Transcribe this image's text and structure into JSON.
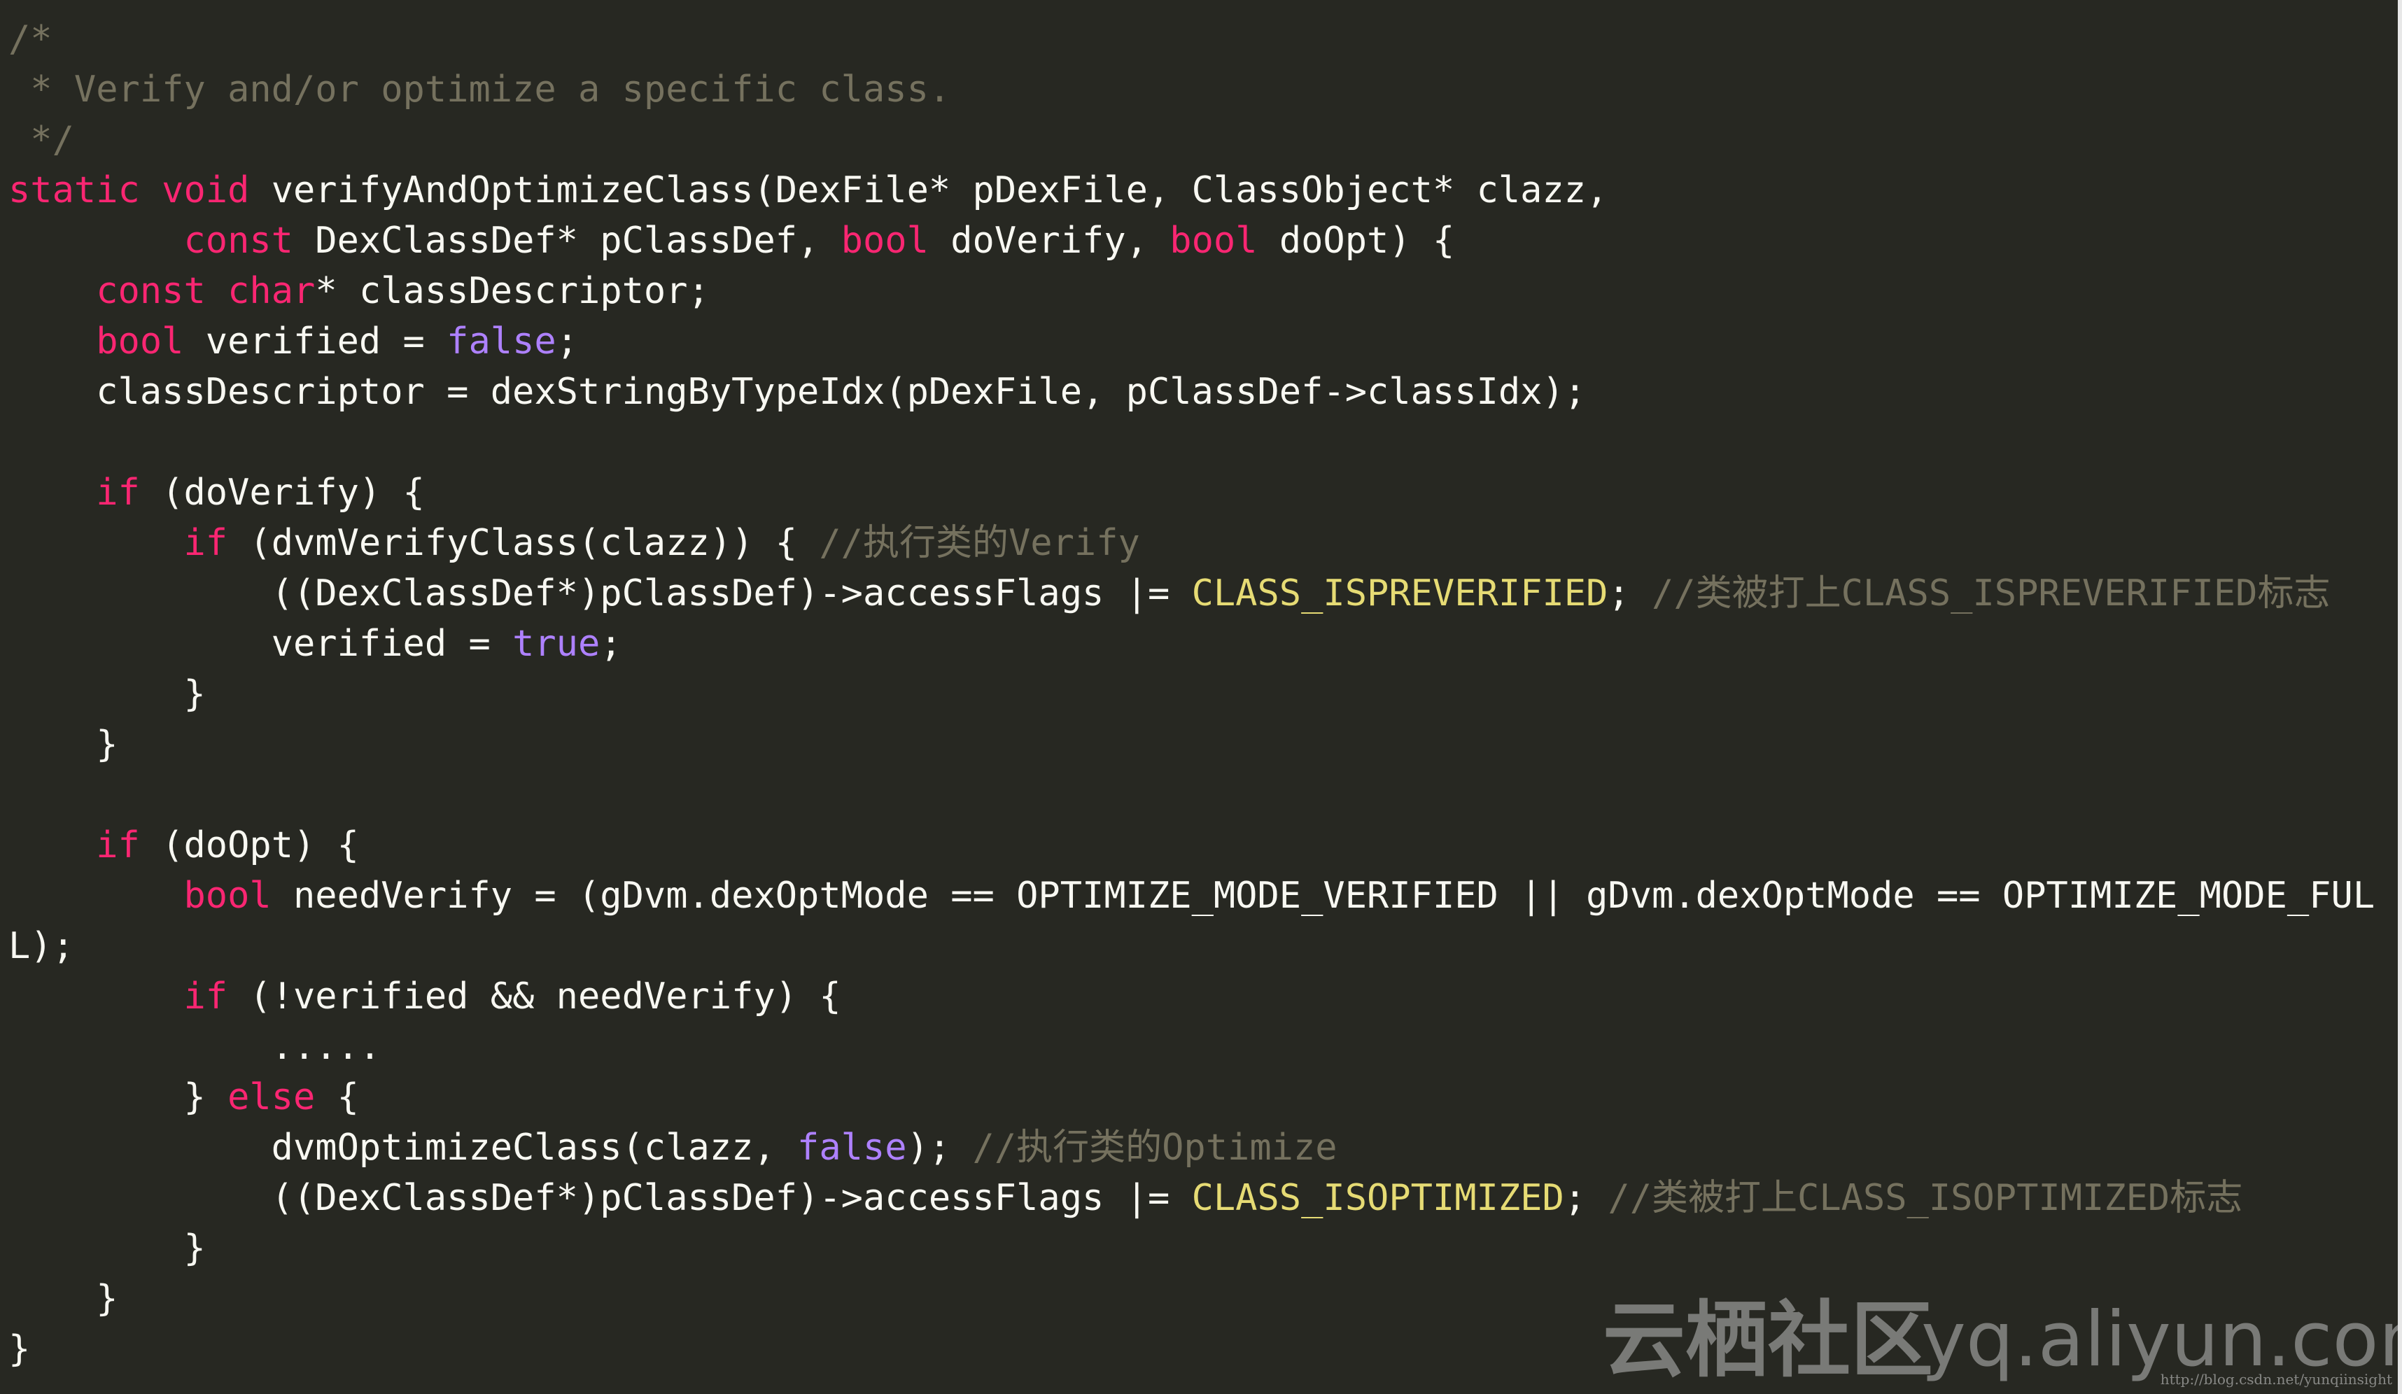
{
  "code_lines": [
    [
      {
        "t": "/*",
        "c": "cm"
      }
    ],
    [
      {
        "t": " * Verify and/or optimize a specific class.",
        "c": "cm"
      }
    ],
    [
      {
        "t": " */",
        "c": "cm"
      }
    ],
    [
      {
        "t": "static",
        "c": "kw"
      },
      {
        "t": " ",
        "c": "pl"
      },
      {
        "t": "void",
        "c": "kw"
      },
      {
        "t": " verifyAndOptimizeClass(DexFile* pDexFile, ClassObject* clazz,",
        "c": "pl"
      }
    ],
    [
      {
        "t": "        ",
        "c": "pl"
      },
      {
        "t": "const",
        "c": "kw"
      },
      {
        "t": " DexClassDef* pClassDef, ",
        "c": "pl"
      },
      {
        "t": "bool",
        "c": "kw"
      },
      {
        "t": " doVerify, ",
        "c": "pl"
      },
      {
        "t": "bool",
        "c": "kw"
      },
      {
        "t": " doOpt) {",
        "c": "pl"
      }
    ],
    [
      {
        "t": "    ",
        "c": "pl"
      },
      {
        "t": "const",
        "c": "kw"
      },
      {
        "t": " ",
        "c": "pl"
      },
      {
        "t": "char",
        "c": "kw"
      },
      {
        "t": "* classDescriptor;",
        "c": "pl"
      }
    ],
    [
      {
        "t": "    ",
        "c": "pl"
      },
      {
        "t": "bool",
        "c": "kw"
      },
      {
        "t": " verified = ",
        "c": "pl"
      },
      {
        "t": "false",
        "c": "cst"
      },
      {
        "t": ";",
        "c": "pl"
      }
    ],
    [
      {
        "t": "    classDescriptor = dexStringByTypeIdx(pDexFile, pClassDef->classIdx);",
        "c": "pl"
      }
    ],
    [],
    [
      {
        "t": "    ",
        "c": "pl"
      },
      {
        "t": "if",
        "c": "kw"
      },
      {
        "t": " (doVerify) {",
        "c": "pl"
      }
    ],
    [
      {
        "t": "        ",
        "c": "pl"
      },
      {
        "t": "if",
        "c": "kw"
      },
      {
        "t": " (dvmVerifyClass(clazz)) { ",
        "c": "pl"
      },
      {
        "t": "//执行类的Verify",
        "c": "cm"
      }
    ],
    [
      {
        "t": "            ((DexClassDef*)pClassDef)->accessFlags |= ",
        "c": "pl"
      },
      {
        "t": "CLASS_ISPREVERIFIED",
        "c": "mac"
      },
      {
        "t": "; ",
        "c": "pl"
      },
      {
        "t": "//类被打上CLASS_ISPREVERIFIED标志",
        "c": "cm"
      }
    ],
    [
      {
        "t": "            verified = ",
        "c": "pl"
      },
      {
        "t": "true",
        "c": "cst"
      },
      {
        "t": ";",
        "c": "pl"
      }
    ],
    [
      {
        "t": "        }",
        "c": "pl"
      }
    ],
    [
      {
        "t": "    }",
        "c": "pl"
      }
    ],
    [],
    [
      {
        "t": "    ",
        "c": "pl"
      },
      {
        "t": "if",
        "c": "kw"
      },
      {
        "t": " (doOpt) {",
        "c": "pl"
      }
    ],
    [
      {
        "t": "        ",
        "c": "pl"
      },
      {
        "t": "bool",
        "c": "kw"
      },
      {
        "t": " needVerify = (gDvm.dexOptMode == OPTIMIZE_MODE_VERIFIED || gDvm.dexOptMode == OPTIMIZE_MODE_FUL",
        "c": "pl"
      }
    ],
    [
      {
        "t": "L);",
        "c": "pl"
      }
    ],
    [
      {
        "t": "        ",
        "c": "pl"
      },
      {
        "t": "if",
        "c": "kw"
      },
      {
        "t": " (!verified && needVerify) {",
        "c": "pl"
      }
    ],
    [
      {
        "t": "            .....",
        "c": "pl"
      }
    ],
    [
      {
        "t": "        } ",
        "c": "pl"
      },
      {
        "t": "else",
        "c": "kw"
      },
      {
        "t": " {",
        "c": "pl"
      }
    ],
    [
      {
        "t": "            dvmOptimizeClass(clazz, ",
        "c": "pl"
      },
      {
        "t": "false",
        "c": "cst"
      },
      {
        "t": "); ",
        "c": "pl"
      },
      {
        "t": "//执行类的Optimize",
        "c": "cm"
      }
    ],
    [
      {
        "t": "            ((DexClassDef*)pClassDef)->accessFlags |= ",
        "c": "pl"
      },
      {
        "t": "CLASS_ISOPTIMIZED",
        "c": "mac"
      },
      {
        "t": "; ",
        "c": "pl"
      },
      {
        "t": "//类被打上CLASS_ISOPTIMIZED标志",
        "c": "cm"
      }
    ],
    [
      {
        "t": "        }",
        "c": "pl"
      }
    ],
    [
      {
        "t": "    }",
        "c": "pl"
      }
    ],
    [
      {
        "t": "}",
        "c": "pl"
      }
    ]
  ],
  "colors": {
    "background": "#272822",
    "keyword": "#f92672",
    "constant": "#ae81ff",
    "macro": "#e6db74",
    "comment": "#75715e",
    "plain": "#f8f8f2"
  },
  "watermark": {
    "brand_cn": "云栖社区",
    "brand_url": "yq.aliyun.com",
    "blog_url": "http://blog.csdn.net/yunqiinsight"
  }
}
